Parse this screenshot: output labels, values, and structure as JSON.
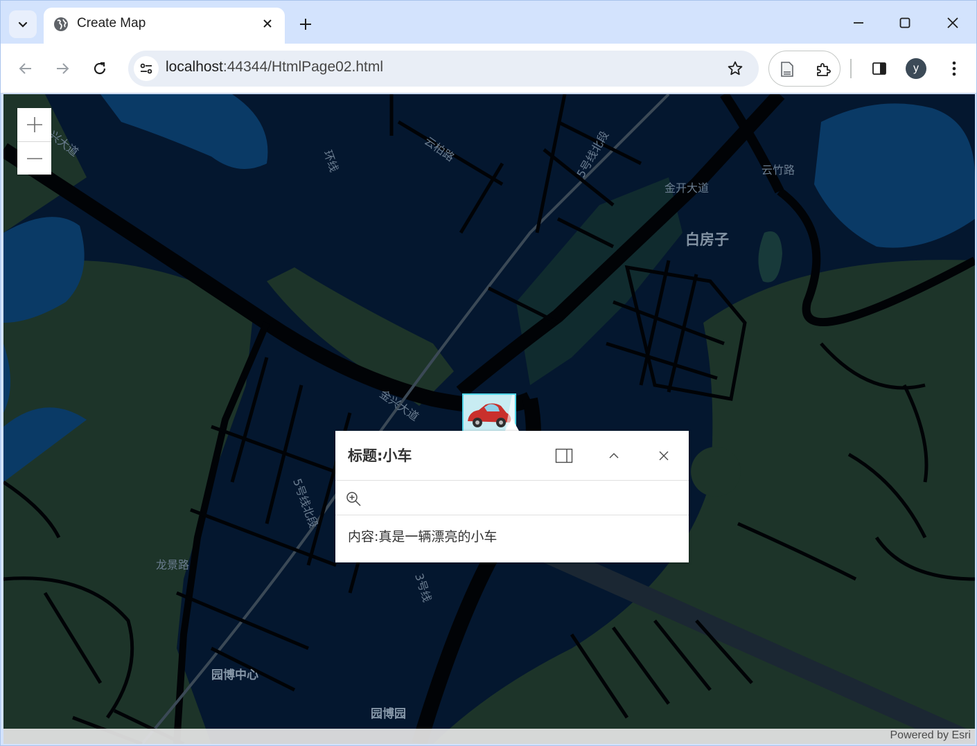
{
  "browser": {
    "tab_title": "Create Map",
    "url_host": "localhost",
    "url_rest": ":44344/HtmlPage02.html",
    "profile_initial": "y"
  },
  "map": {
    "labels": {
      "jinxing_dadao_top": "兴大道",
      "yunbai_lu": "云柏路",
      "line5_north_top": "5号线北段",
      "yunzhu_lu": "云竹路",
      "jinkai_dadao": "金开大道",
      "baifangzi": "白房子",
      "jinxing_dadao_mid": "金兴大道",
      "longjing_lu": "龙景路",
      "line5_north_mid": "5号线北段",
      "line3": "3号线",
      "yuanbo_center": "园博中心",
      "yuanbo_yuan": "园博园",
      "road_left_top": "环线"
    },
    "zoom_in_icon": "plus-icon",
    "zoom_out_icon": "minus-icon",
    "attribution": "Powered by Esri"
  },
  "popup": {
    "title": "标题:小车",
    "content": "内容:真是一辆漂亮的小车"
  },
  "colors": {
    "map_background": "#04172f",
    "green_area": "#1d3429",
    "water": "#0a3a66",
    "road": "#010306",
    "marker_border": "#4fd6e8"
  }
}
